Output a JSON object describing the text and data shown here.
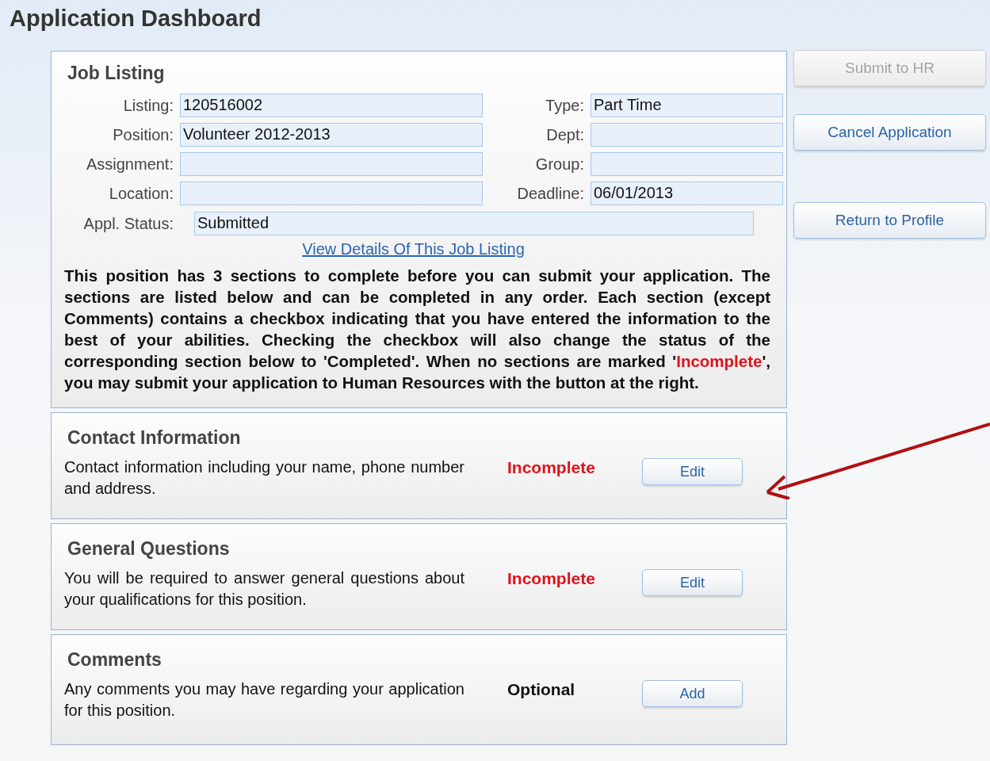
{
  "page": {
    "title": "Application Dashboard"
  },
  "job_listing": {
    "title": "Job Listing",
    "fields_left": [
      {
        "label": "Listing:",
        "value": "120516002"
      },
      {
        "label": "Position:",
        "value": "Volunteer 2012-2013"
      },
      {
        "label": "Assignment:"
      },
      {
        "label": "Location:"
      }
    ],
    "fields_right": [
      {
        "label": "Type:",
        "value": "Part Time"
      },
      {
        "label": "Dept:"
      },
      {
        "label": "Group:"
      },
      {
        "label": "Deadline:",
        "value": "06/01/2013"
      }
    ],
    "status_field": {
      "label": "Appl. Status:",
      "value": "Submitted"
    },
    "details_link": "View Details Of This Job Listing",
    "instructions": [
      {
        "kind": "plain",
        "text": "This position has 3 sections to complete before you can submit your application. The sections are listed below and can be completed in any order. Each section (except Comments) contains a checkbox indicating that you have entered the information to the best of your abilities. Checking the checkbox will also change the status of the corresponding section below to 'Completed'. When no sections are marked '"
      },
      {
        "kind": "alert",
        "text": "Incomplete"
      },
      {
        "kind": "plain",
        "text": "', you may submit your application to Human Resources with the button at the right."
      }
    ]
  },
  "sections": [
    {
      "title": "Contact Information",
      "description": "Contact information including your name, phone number and address.",
      "status": "Incomplete",
      "kind": "incomplete",
      "button": "Edit"
    },
    {
      "title": "General Questions",
      "description": "You will be required to answer general questions about your qualifications for this position.",
      "status": "Incomplete",
      "kind": "incomplete",
      "button": "Edit"
    },
    {
      "title": "Comments",
      "description": "Any comments you may have regarding your application for this position.",
      "status": "Optional",
      "kind": "optional",
      "button": "Add"
    }
  ],
  "actions": [
    {
      "label": "Submit to HR",
      "disabled": true
    },
    {
      "label": "Cancel Application",
      "disabled": false
    },
    {
      "label": "Return to Profile",
      "disabled": false
    }
  ]
}
